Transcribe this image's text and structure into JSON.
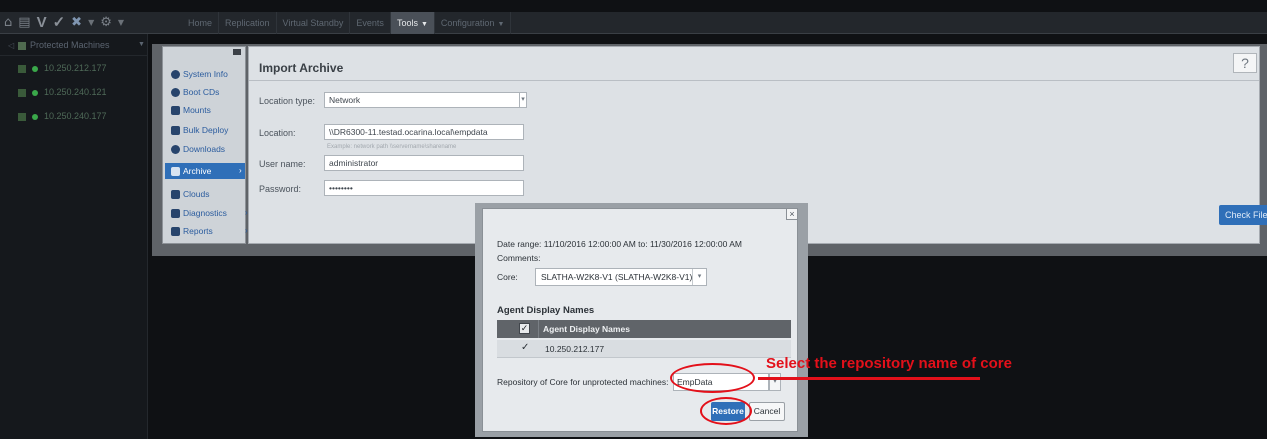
{
  "topbar": {
    "icons": [
      "home-icon",
      "chart-icon",
      "v-logo",
      "wrench-icon",
      "gear-icon"
    ],
    "logo_text": "V",
    "tabs": [
      {
        "label": "Home"
      },
      {
        "label": "Replication"
      },
      {
        "label": "Virtual Standby"
      },
      {
        "label": "Events"
      },
      {
        "label": "Tools",
        "active": true
      },
      {
        "label": "Configuration"
      }
    ]
  },
  "sidebar": {
    "header": "Protected Machines",
    "machines": [
      {
        "label": "10.250.212.177"
      },
      {
        "label": "10.250.240.121"
      },
      {
        "label": "10.250.240.177"
      }
    ]
  },
  "tools_menu": {
    "items": [
      {
        "label": "System Info",
        "icon": "gear-icon"
      },
      {
        "label": "Boot CDs",
        "icon": "disc-icon"
      },
      {
        "label": "Mounts",
        "icon": "mount-icon"
      },
      {
        "label": "Bulk Deploy",
        "icon": "deploy-icon"
      },
      {
        "label": "Downloads",
        "icon": "download-icon"
      },
      {
        "label": "Archive",
        "icon": "archive-icon",
        "active": true
      },
      {
        "label": "Clouds",
        "icon": "cloud-icon"
      },
      {
        "label": "Diagnostics",
        "icon": "diagnostics-icon"
      },
      {
        "label": "Reports",
        "icon": "chart-icon"
      }
    ]
  },
  "import_archive": {
    "title": "Import Archive",
    "help": "?",
    "location_type_label": "Location type:",
    "location_type_value": "Network",
    "location_label": "Location:",
    "location_value": "\\\\DR6300-11.testad.ocarina.local\\empdata",
    "location_hint": "Example: network path \\\\servername\\sharename",
    "username_label": "User name:",
    "username_value": "administrator",
    "password_label": "Password:",
    "password_value": "••••••••",
    "check_file": "Check File"
  },
  "modal": {
    "close": "×",
    "date_range": "Date range: 11/10/2016 12:00:00 AM  to: 11/30/2016 12:00:00 AM",
    "comments_label": "Comments:",
    "core_label": "Core:",
    "core_value": "SLATHA-W2K8-V1 (SLATHA-W2K8-V1)",
    "agent_section_title": "Agent Display Names",
    "table_header": "Agent Display Names",
    "rows": [
      {
        "name": "10.250.212.177",
        "checked": true
      }
    ],
    "repo_label": "Repository of Core for unprotected machines:",
    "repo_value": "EmpData",
    "restore": "Restore",
    "cancel": "Cancel"
  },
  "annotation": {
    "text": "Select the repository name of core",
    "color": "#e3101a"
  }
}
